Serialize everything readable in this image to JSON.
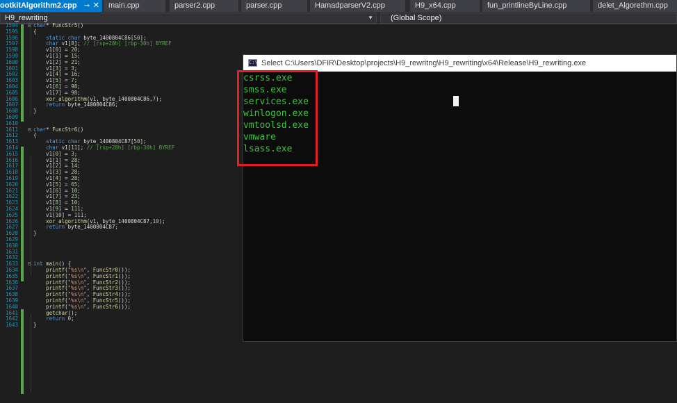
{
  "tabs": [
    {
      "label": "ootkitAlgorithm2.cpp",
      "pin": "⊸",
      "close": "✕"
    },
    {
      "label": "main.cpp"
    },
    {
      "label": "parser2.cpp"
    },
    {
      "label": "parser.cpp"
    },
    {
      "label": "HamadparserV2.cpp"
    },
    {
      "label": "H9_x64.cpp"
    },
    {
      "label": "fun_printlineByLine.cpp"
    },
    {
      "label": "delet_Algorethm.cpp"
    }
  ],
  "navbar": {
    "project": "H9_rewriting",
    "scope": "(Global Scope)"
  },
  "code_lines": [
    {
      "n": "1594",
      "t": "char* FuncStr5()"
    },
    {
      "n": "1595",
      "t": "{"
    },
    {
      "n": "1596",
      "t": "    static char byte_1400804C86[50];"
    },
    {
      "n": "1597",
      "t": "    char v1[8]; // [rsp+28h] [rbp-30h] BYREF"
    },
    {
      "n": "1598",
      "t": "    v1[0] = 20;"
    },
    {
      "n": "1599",
      "t": "    v1[1] = 15;"
    },
    {
      "n": "1600",
      "t": "    v1[2] = 21;"
    },
    {
      "n": "1601",
      "t": "    v1[3] = 3;"
    },
    {
      "n": "1602",
      "t": "    v1[4] = 16;"
    },
    {
      "n": "1603",
      "t": "    v1[5] = 7;"
    },
    {
      "n": "1604",
      "t": "    v1[6] = 98;"
    },
    {
      "n": "1605",
      "t": "    v1[7] = 98;"
    },
    {
      "n": "1606",
      "t": "    xor_algorithm(v1, byte_1400804C86,7);"
    },
    {
      "n": "1607",
      "t": "    return byte_1400804C86;"
    },
    {
      "n": "1608",
      "t": "}"
    },
    {
      "n": "1609",
      "t": ""
    },
    {
      "n": "1610",
      "t": ""
    },
    {
      "n": "1611",
      "t": "char* FuncStr6()"
    },
    {
      "n": "1612",
      "t": "{"
    },
    {
      "n": "1613",
      "t": "    static char byte_1400804C87[50];"
    },
    {
      "n": "1614",
      "t": "    char v1[11]; // [rsp+28h] [rbp-30h] BYREF"
    },
    {
      "n": "1615",
      "t": "    v1[0] = 3;"
    },
    {
      "n": "1616",
      "t": "    v1[1] = 28;"
    },
    {
      "n": "1617",
      "t": "    v1[2] = 14;"
    },
    {
      "n": "1618",
      "t": "    v1[3] = 28;"
    },
    {
      "n": "1619",
      "t": "    v1[4] = 28;"
    },
    {
      "n": "1620",
      "t": "    v1[5] = 65;"
    },
    {
      "n": "1621",
      "t": "    v1[6] = 10;"
    },
    {
      "n": "1622",
      "t": "    v1[7] = 23;"
    },
    {
      "n": "1623",
      "t": "    v1[8] = 10;"
    },
    {
      "n": "1624",
      "t": "    v1[9] = 111;"
    },
    {
      "n": "1625",
      "t": "    v1[10] = 111;"
    },
    {
      "n": "1626",
      "t": "    xor_algorithm(v1, byte_1400804C87,10);"
    },
    {
      "n": "1627",
      "t": "    return byte_1400804C87;"
    },
    {
      "n": "1628",
      "t": "}"
    },
    {
      "n": "1629",
      "t": ""
    },
    {
      "n": "1630",
      "t": ""
    },
    {
      "n": "1631",
      "t": ""
    },
    {
      "n": "1632",
      "t": ""
    },
    {
      "n": "1633",
      "t": "int main() {"
    },
    {
      "n": "1634",
      "t": "    printf(\"%s\\n\", FuncStr0());"
    },
    {
      "n": "1635",
      "t": "    printf(\"%s\\n\", FuncStr1());"
    },
    {
      "n": "1636",
      "t": "    printf(\"%s\\n\", FuncStr2());"
    },
    {
      "n": "1637",
      "t": "    printf(\"%s\\n\", FuncStr3());"
    },
    {
      "n": "1638",
      "t": "    printf(\"%s\\n\", FuncStr4());"
    },
    {
      "n": "1639",
      "t": "    printf(\"%s\\n\", FuncStr5());"
    },
    {
      "n": "1640",
      "t": "    printf(\"%s\\n\", FuncStr6());"
    },
    {
      "n": "1641",
      "t": "    getchar();"
    },
    {
      "n": "1642",
      "t": "    return 0;"
    },
    {
      "n": "1643",
      "t": "}"
    }
  ],
  "console": {
    "title": "Select C:\\Users\\DFIR\\Desktop\\projects\\H9_rewritng\\H9_rewriting\\x64\\Release\\H9_rewriting.exe",
    "output": [
      "csrss.exe",
      "smss.exe",
      "services.exe",
      "winlogon.exe",
      "vmtoolsd.exe",
      "vmware",
      "lsass.exe"
    ]
  },
  "colors": {
    "keyword": "#569cd6",
    "comment": "#57a64a",
    "string": "#d69d85",
    "number": "#b5cea8",
    "function": "#dcdcaa",
    "line_number": "#2b91af",
    "console_text": "#3cc43c",
    "highlight_box": "#e61e24",
    "tab_active": "#007acc"
  },
  "icons": {
    "fold": "fold-minus-icon",
    "console": "console-app-icon",
    "pin": "pin-icon",
    "close": "close-icon",
    "dropdown": "chevron-down-icon"
  }
}
